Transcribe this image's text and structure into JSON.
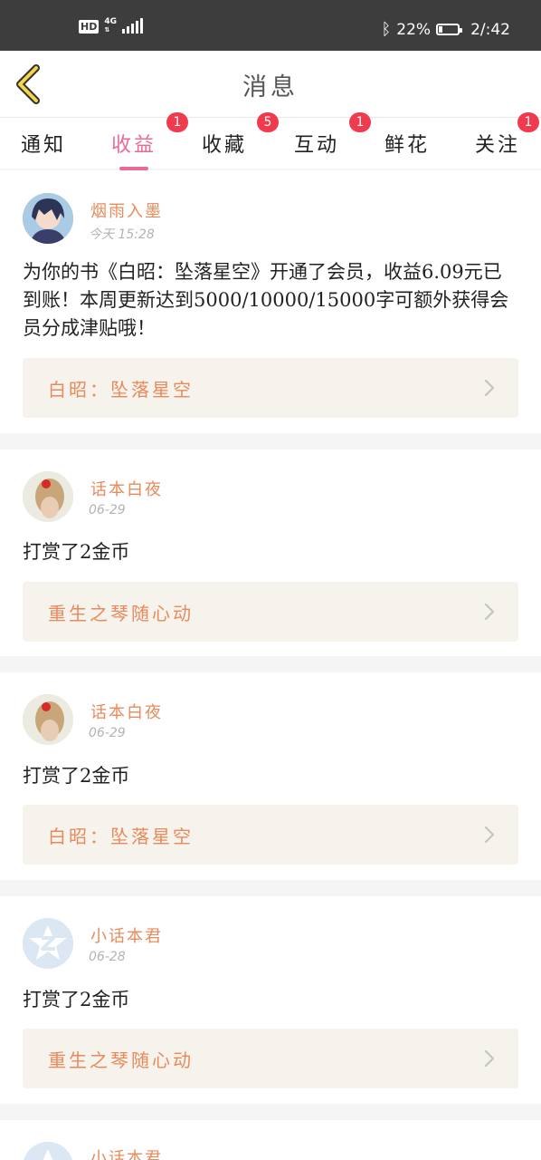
{
  "status_bar": {
    "hd": "HD",
    "network": "4G",
    "battery_percent": "22%",
    "battery_level": 0.22,
    "time": "2/:42"
  },
  "header": {
    "title": "消息",
    "back_icon": "chevron-left-icon"
  },
  "tabs": [
    {
      "label": "通知",
      "badge": "",
      "active": false
    },
    {
      "label": "收益",
      "badge": "1",
      "active": true
    },
    {
      "label": "收藏",
      "badge": "5",
      "active": false
    },
    {
      "label": "互动",
      "badge": "1",
      "active": false
    },
    {
      "label": "鲜花",
      "badge": "",
      "active": false
    },
    {
      "label": "关注",
      "badge": "1",
      "active": false
    }
  ],
  "messages": [
    {
      "user": "烟雨入墨",
      "time": "今天 15:28",
      "text": "为你的书《白昭：坠落星空》开通了会员，收益6.09元已到账！本周更新达到5000/10000/15000字可额外获得会员分成津贴哦！",
      "book": "白昭：坠落星空"
    },
    {
      "user": "话本白夜",
      "time": "06-29",
      "text": "打赏了2金币",
      "book": "重生之琴随心动"
    },
    {
      "user": "话本白夜",
      "time": "06-29",
      "text": "打赏了2金币",
      "book": "白昭：坠落星空"
    },
    {
      "user": "小话本君",
      "time": "06-28",
      "text": "打赏了2金币",
      "book": "重生之琴随心动"
    },
    {
      "user": "小话本君"
    }
  ],
  "colors": {
    "accent": "#e86a9a",
    "badge": "#f03a4e",
    "username": "#e88a5c",
    "book_bg": "#f5f3eb"
  }
}
